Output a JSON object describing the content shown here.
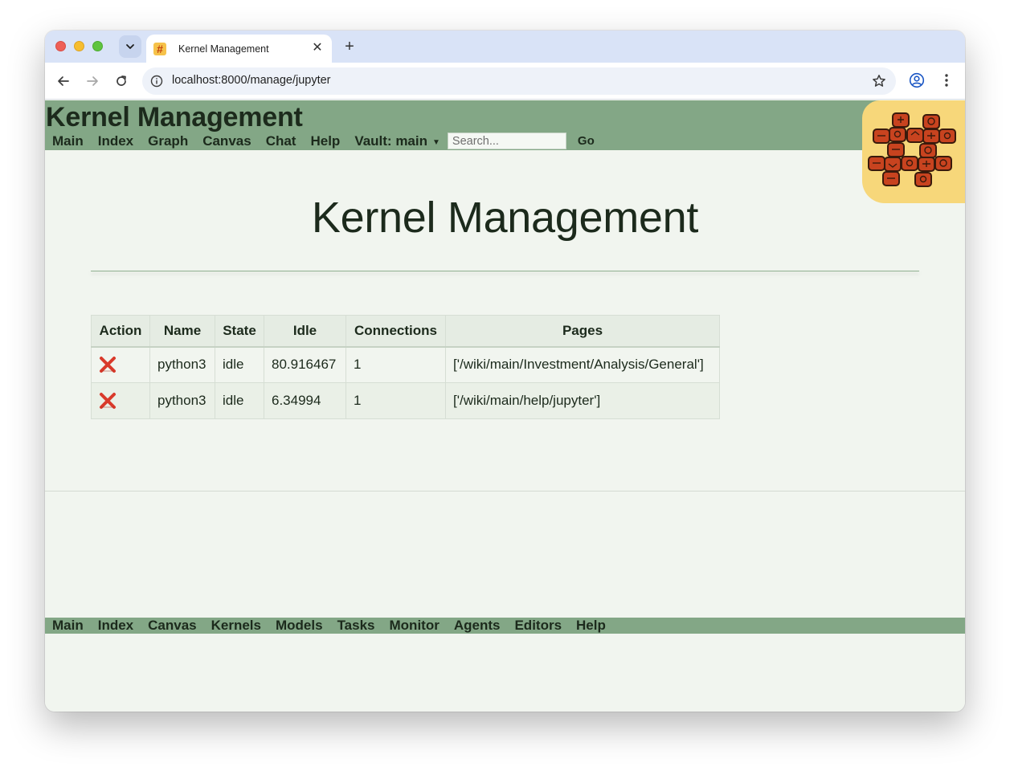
{
  "browser": {
    "tab_title": "Kernel Management",
    "favicon_glyph": "#",
    "url": "localhost:8000/manage/jupyter",
    "close_glyph": "✕",
    "new_tab_glyph": "+"
  },
  "header": {
    "site_title": "Kernel Management",
    "nav": [
      "Main",
      "Index",
      "Graph",
      "Canvas",
      "Chat",
      "Help"
    ],
    "vault_label": "Vault: main",
    "vault_arrow": "▼",
    "search_placeholder": "Search...",
    "go_label": "Go"
  },
  "main": {
    "heading": "Kernel Management",
    "table": {
      "columns": [
        "Action",
        "Name",
        "State",
        "Idle",
        "Connections",
        "Pages"
      ],
      "rows": [
        {
          "name": "python3",
          "state": "idle",
          "idle": "80.916467",
          "connections": "1",
          "pages": "['/wiki/main/Investment/Analysis/General']"
        },
        {
          "name": "python3",
          "state": "idle",
          "idle": "6.34994",
          "connections": "1",
          "pages": "['/wiki/main/help/jupyter']"
        }
      ]
    }
  },
  "footer": {
    "nav": [
      "Main",
      "Index",
      "Canvas",
      "Kernels",
      "Models",
      "Tasks",
      "Monitor",
      "Agents",
      "Editors",
      "Help"
    ]
  },
  "colors": {
    "header_green": "#83a786",
    "page_bg": "#f1f5ef",
    "kill_red": "#d93a2b",
    "logo_bg": "#f7d77a",
    "logo_tile": "#c8431f"
  }
}
